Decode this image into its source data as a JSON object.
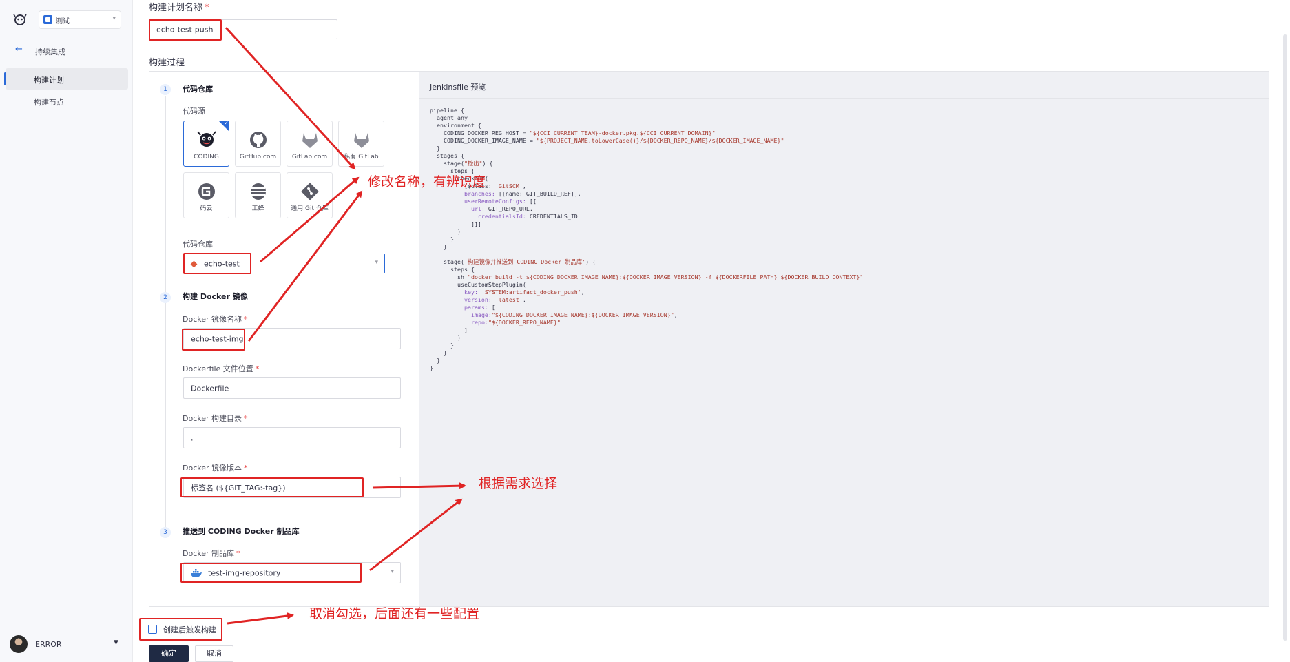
{
  "sidebar": {
    "project_name": "测试",
    "back_label": "持续集成",
    "nav": [
      {
        "label": "构建计划",
        "active": true
      },
      {
        "label": "构建节点",
        "active": false
      }
    ],
    "user": {
      "name": "ERROR"
    }
  },
  "form": {
    "plan_name_label": "构建计划名称",
    "required_mark": "*",
    "plan_name_value": "echo-test-push",
    "process_label": "构建过程",
    "steps": [
      {
        "number": "1",
        "title": "代码仓库"
      },
      {
        "number": "2",
        "title": "构建 Docker 镜像"
      },
      {
        "number": "3",
        "title": "推送到 CODING Docker 制品库"
      }
    ],
    "source_label": "代码源",
    "sources": [
      {
        "name": "CODING",
        "icon": "coding-octopus-icon",
        "selected": true
      },
      {
        "name": "GitHub.com",
        "icon": "github-icon",
        "selected": false
      },
      {
        "name": "GitLab.com",
        "icon": "gitlab-icon",
        "selected": false
      },
      {
        "name": "私有 GitLab",
        "icon": "gitlab-private-icon",
        "selected": false
      },
      {
        "name": "码云",
        "icon": "gitee-icon",
        "selected": false
      },
      {
        "name": "工蜂",
        "icon": "gongfeng-icon",
        "selected": false
      },
      {
        "name": "通用 Git 仓库",
        "icon": "git-icon",
        "selected": false
      }
    ],
    "repo_label": "代码仓库",
    "repo_value": "echo-test",
    "image_name_label": "Docker 镜像名称",
    "image_name_value": "echo-test-img",
    "dockerfile_label": "Dockerfile 文件位置",
    "dockerfile_value": "Dockerfile",
    "build_dir_label": "Docker 构建目录",
    "build_dir_value": ".",
    "image_version_label": "Docker 镜像版本",
    "image_version_value": "标签名 (${GIT_TAG:-tag})",
    "registry_label": "Docker 制品库",
    "registry_value": "test-img-repository",
    "trigger_label": "创建后触发构建",
    "trigger_checked": false,
    "confirm_label": "确定",
    "cancel_label": "取消"
  },
  "preview": {
    "title": "Jenkinsfile 预览"
  },
  "annotations": {
    "rename": "修改名称，有辨识度",
    "select": "根据需求选择",
    "uncheck": "取消勾选，后面还有一些配置"
  },
  "colors": {
    "accent": "#2b6ad8",
    "annotation_red": "#e02424",
    "primary_button": "#1f2a44",
    "preview_bg": "#eff0f4"
  }
}
